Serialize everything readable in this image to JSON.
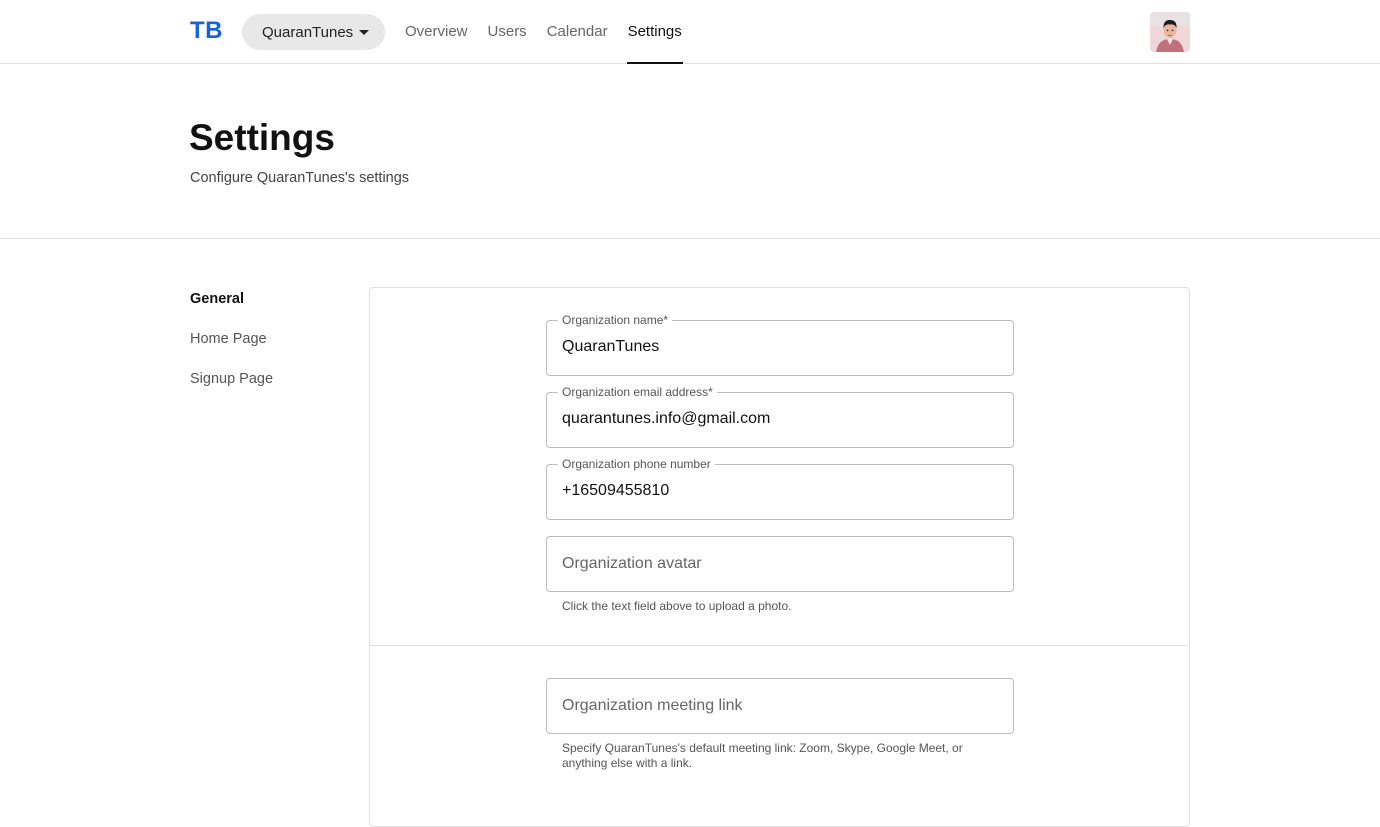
{
  "topbar": {
    "logo": "TB",
    "org_selector": "QuaranTunes",
    "nav": [
      {
        "label": "Overview",
        "active": false
      },
      {
        "label": "Users",
        "active": false
      },
      {
        "label": "Calendar",
        "active": false
      },
      {
        "label": "Settings",
        "active": true
      }
    ],
    "avatar_icon": "user-avatar-photo"
  },
  "header": {
    "title": "Settings",
    "subtitle": "Configure QuaranTunes's settings"
  },
  "sidebar": {
    "items": [
      {
        "label": "General",
        "active": true
      },
      {
        "label": "Home Page",
        "active": false
      },
      {
        "label": "Signup Page",
        "active": false
      }
    ]
  },
  "form": {
    "org_name": {
      "label": "Organization name*",
      "value": "QuaranTunes"
    },
    "org_email": {
      "label": "Organization email address*",
      "value": "quarantunes.info@gmail.com"
    },
    "org_phone": {
      "label": "Organization phone number",
      "value": "+16509455810"
    },
    "org_avatar": {
      "placeholder": "Organization avatar",
      "helper": "Click the text field above to upload a photo."
    },
    "org_meeting_link": {
      "placeholder": "Organization meeting link",
      "helper": "Specify QuaranTunes's default meeting link: Zoom, Skype, Google Meet, or anything else with a link."
    }
  },
  "colors": {
    "brand": "#1565d8",
    "border": "#e0e0e0",
    "selector_bg": "#e8e8e8"
  }
}
